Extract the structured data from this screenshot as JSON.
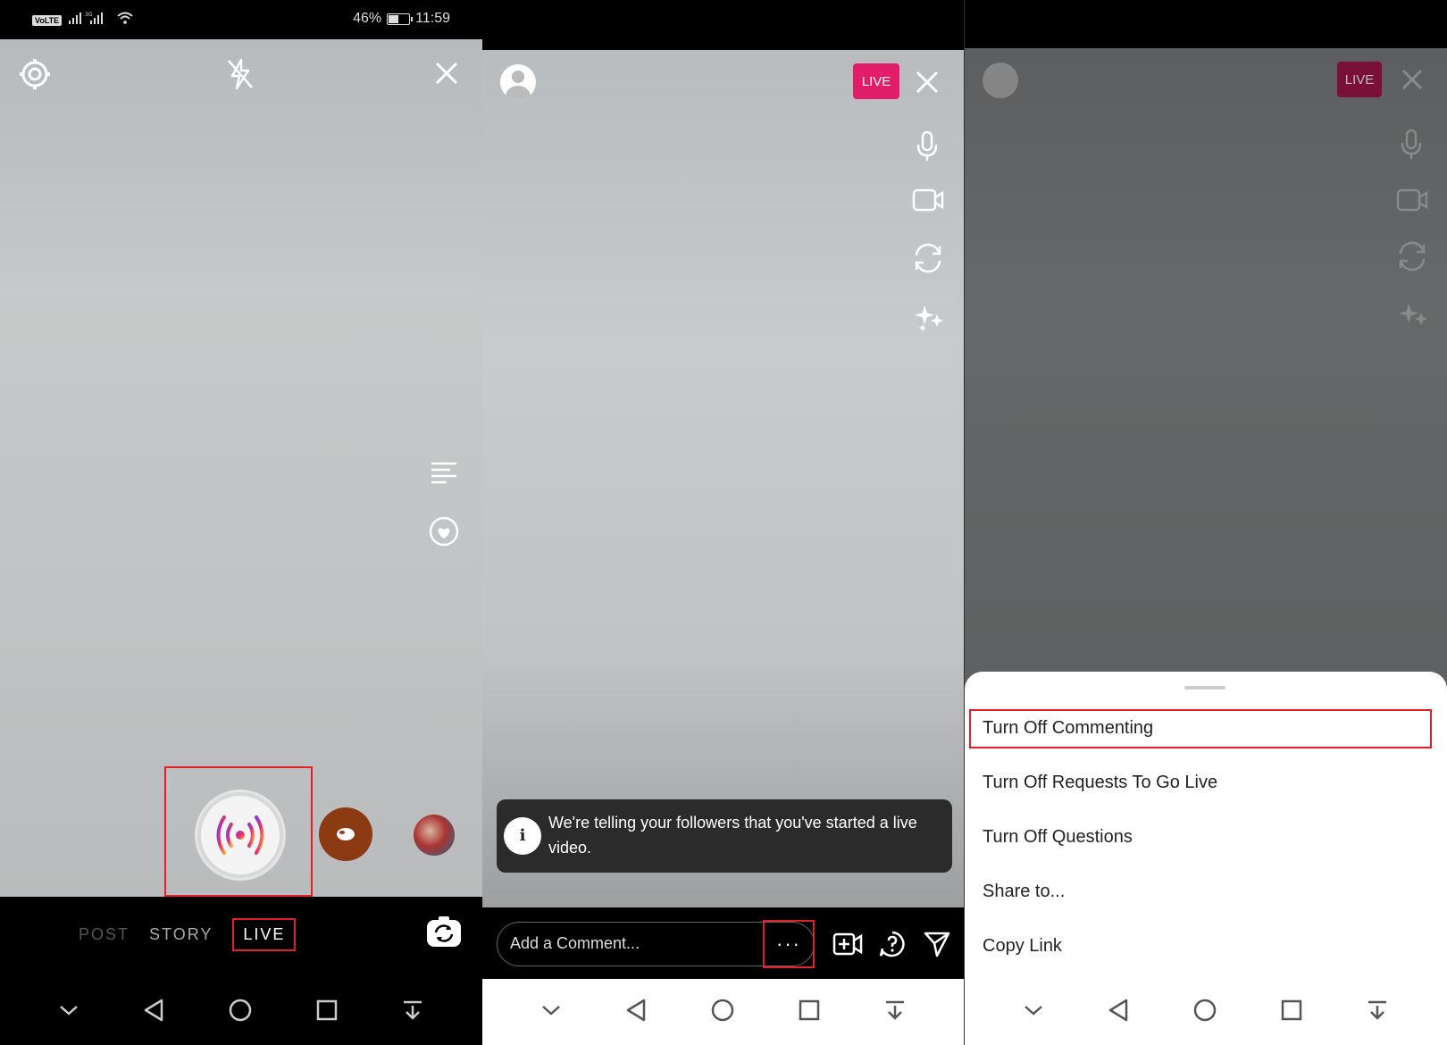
{
  "status_bar": {
    "network_label": "VoLTE",
    "network_type": "3G",
    "battery_percent": "46%",
    "battery_level": 0.46,
    "time": "11:59"
  },
  "panel1": {
    "modes": [
      "POST",
      "STORY",
      "LIVE"
    ],
    "active_mode": "LIVE",
    "icons": [
      "settings-icon",
      "flash-off-icon",
      "close-icon",
      "text-icon",
      "face-filter-icon",
      "live-broadcast-icon",
      "flip-camera-icon"
    ]
  },
  "panel2": {
    "live_badge": "LIVE",
    "toast_text": "We're telling your followers that you've started a live video.",
    "toast_icon": "i",
    "comment_placeholder": "Add a Comment...",
    "more_label": "···",
    "icons": [
      "microphone-icon",
      "video-camera-icon",
      "flip-camera-icon",
      "sparkles-icon",
      "add-guest-icon",
      "question-icon",
      "send-icon"
    ]
  },
  "panel3": {
    "live_badge": "LIVE",
    "menu": [
      "Turn Off Commenting",
      "Turn Off Requests To Go Live",
      "Turn Off Questions",
      "Share to...",
      "Copy Link"
    ]
  },
  "colors": {
    "highlight": "#e0212b",
    "live_badge": "#e11d6a"
  }
}
